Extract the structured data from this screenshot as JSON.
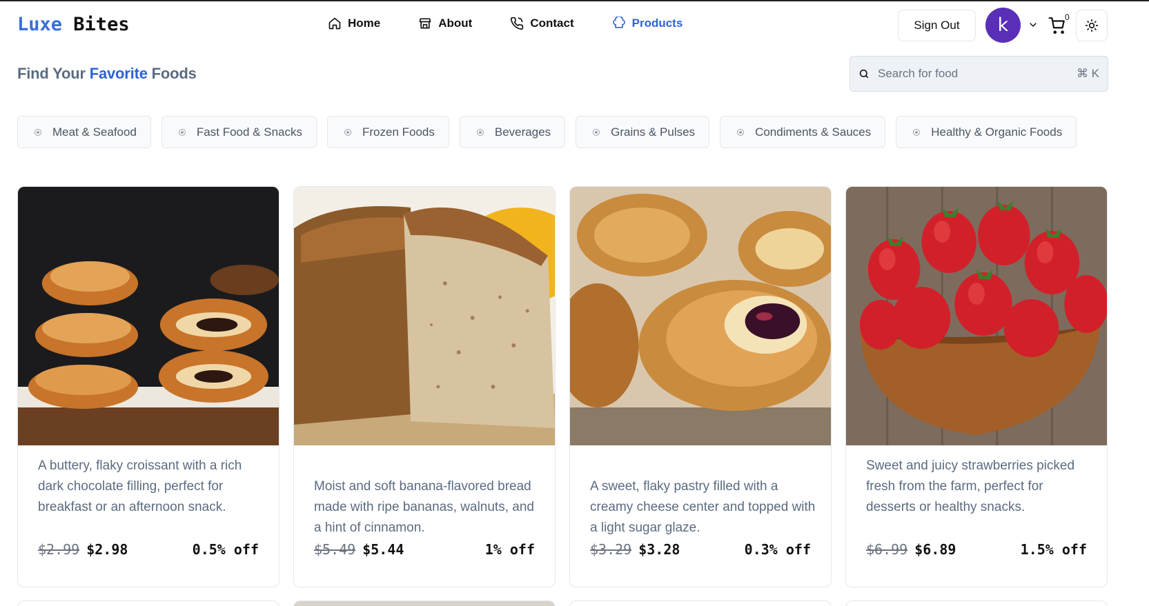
{
  "brand": {
    "part1": "Luxe",
    "part2": "Bites"
  },
  "nav": {
    "items": [
      {
        "label": "Home",
        "icon": "home-icon"
      },
      {
        "label": "About",
        "icon": "store-icon"
      },
      {
        "label": "Contact",
        "icon": "phone-icon"
      },
      {
        "label": "Products",
        "icon": "chef-hat-icon",
        "active": true
      }
    ]
  },
  "account": {
    "signout_label": "Sign Out",
    "avatar_initial": "k",
    "cart_count": "0"
  },
  "title": {
    "pre": "Find Your ",
    "highlight": "Favorite",
    "post": " Foods"
  },
  "search": {
    "placeholder": "Search for food",
    "shortcut": "⌘ K"
  },
  "categories": [
    "Meat & Seafood",
    "Fast Food & Snacks",
    "Frozen Foods",
    "Beverages",
    "Grains & Pulses",
    "Condiments & Sauces",
    "Healthy & Organic Foods"
  ],
  "products": [
    {
      "image": "chocolate-croissant",
      "description": "A buttery, flaky croissant with a rich dark chocolate filling, perfect for breakfast or an afternoon snack.",
      "old_price": "$2.99",
      "price": "$2.98",
      "discount": "0.5% off"
    },
    {
      "image": "banana-bread",
      "description": "Moist and soft banana-flavored bread made with ripe bananas, walnuts, and a hint of cinnamon.",
      "old_price": "$5.49",
      "price": "$5.44",
      "discount": "1% off"
    },
    {
      "image": "cheese-danish",
      "description": "A sweet, flaky pastry filled with a creamy cheese center and topped with a light sugar glaze.",
      "old_price": "$3.29",
      "price": "$3.28",
      "discount": "0.3% off"
    },
    {
      "image": "strawberries",
      "description": "Sweet and juicy strawberries picked fresh from the farm, perfect for desserts or healthy snacks.",
      "old_price": "$6.99",
      "price": "$6.89",
      "discount": "1.5% off"
    }
  ],
  "colors": {
    "accent": "#2f63d3",
    "avatar": "#5a2fb7",
    "muted_text": "#5b6b80"
  }
}
